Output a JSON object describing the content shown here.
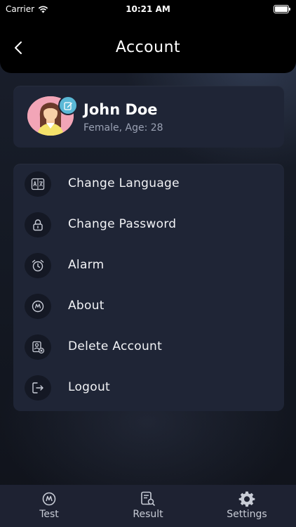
{
  "status_bar": {
    "carrier": "Carrier",
    "time": "10:21 AM"
  },
  "header": {
    "title": "Account"
  },
  "profile": {
    "name": "John Doe",
    "details": "Female, Age: 28"
  },
  "menu": [
    {
      "label": "Change Language",
      "icon": "translate-icon"
    },
    {
      "label": "Change Password",
      "icon": "lock-icon"
    },
    {
      "label": "Alarm",
      "icon": "alarm-clock-icon"
    },
    {
      "label": "About",
      "icon": "info-badge-icon"
    },
    {
      "label": "Delete Account",
      "icon": "delete-user-icon"
    },
    {
      "label": "Logout",
      "icon": "logout-icon"
    }
  ],
  "tabs": [
    {
      "label": "Test",
      "icon": "test-icon"
    },
    {
      "label": "Result",
      "icon": "result-icon"
    },
    {
      "label": "Settings",
      "icon": "gear-icon"
    }
  ],
  "colors": {
    "background": "#11141d",
    "card": "#1f2536",
    "header": "#000000",
    "tab_bar": "#1e2232",
    "accent": "#5ab8d6"
  }
}
